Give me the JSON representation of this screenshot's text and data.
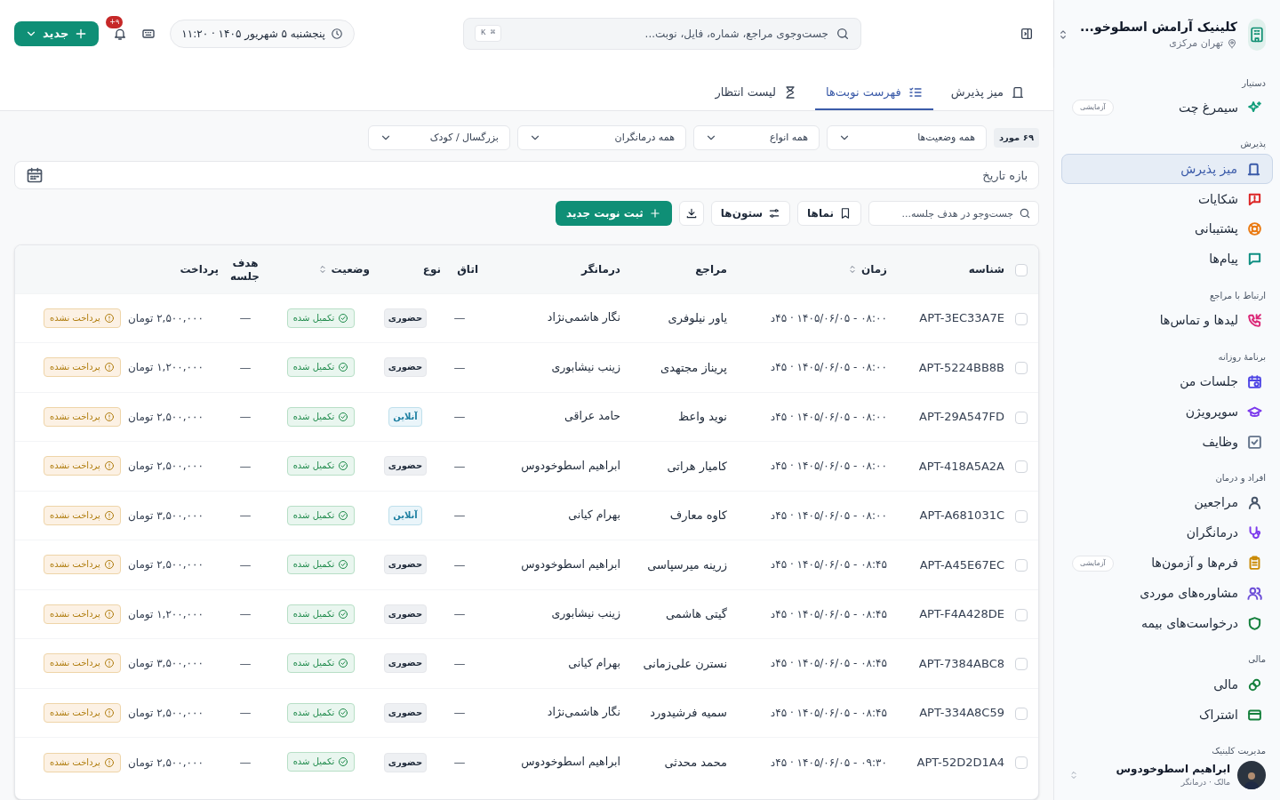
{
  "clinic": {
    "name": "کلینیک آرامش اسطوخو...",
    "location": "تهران مرکزی"
  },
  "sidebar": {
    "groups": [
      {
        "title": "دستیار",
        "items": [
          {
            "label": "سیمرغ چت",
            "selected": false,
            "color": "#0f9d7a",
            "badge": "آزمایشی"
          }
        ]
      },
      {
        "title": "پذیرش",
        "items": [
          {
            "label": "میز پذیرش",
            "selected": true,
            "color": "#3b5ba9"
          },
          {
            "label": "شکایات",
            "selected": false,
            "color": "#dc2626"
          },
          {
            "label": "پشتیبانی",
            "selected": false,
            "color": "#ea7a12"
          },
          {
            "label": "پیام‌ها",
            "selected": false,
            "color": "#0f8f82"
          }
        ]
      },
      {
        "title": "ارتباط با مراجع",
        "items": [
          {
            "label": "لیدها و تماس‌ها",
            "selected": false,
            "color": "#db2777"
          }
        ]
      },
      {
        "title": "برنامهٔ روزانه",
        "items": [
          {
            "label": "جلسات من",
            "selected": false,
            "color": "#4f46e5"
          },
          {
            "label": "سوپرویژن",
            "selected": false,
            "color": "#7c3aed"
          },
          {
            "label": "وظایف",
            "selected": false,
            "color": "#64748b"
          }
        ]
      },
      {
        "title": "افراد و درمان",
        "items": [
          {
            "label": "مراجعین",
            "selected": false,
            "color": "#475569"
          },
          {
            "label": "درمانگران",
            "selected": false,
            "color": "#7c3aed"
          },
          {
            "label": "فرم‌ها و آزمون‌ها",
            "selected": false,
            "color": "#ca8a04",
            "badge": "آزمایشی"
          },
          {
            "label": "مشاوره‌های موردی",
            "selected": false,
            "color": "#6d4fd8"
          },
          {
            "label": "درخواست‌های بیمه",
            "selected": false,
            "color": "#15803d"
          }
        ]
      },
      {
        "title": "مالی",
        "items": [
          {
            "label": "مالی",
            "selected": false,
            "color": "#15803d"
          },
          {
            "label": "اشتراک",
            "selected": false,
            "color": "#15803d"
          }
        ]
      },
      {
        "title": "مدیریت کلینیک"
      }
    ]
  },
  "user": {
    "name": "ابراهیم اسطوخودوس",
    "role": "مالک · درمانگر"
  },
  "topbar": {
    "search_placeholder": "جست‌وجوی مراجع، شماره، فایل، نوبت...",
    "shortcut": "⌘ K",
    "datetime": "پنجشنبه ۵ شهریور ۱۴۰۵ · ۱۱:۲۰",
    "notifications": "۹+",
    "new_button": "جدید"
  },
  "tabs": [
    {
      "label": "میز پذیرش",
      "selected": false
    },
    {
      "label": "فهرست نوبت‌ها",
      "selected": true
    },
    {
      "label": "لیست انتظار",
      "selected": false
    }
  ],
  "count": "۶۹ مورد",
  "filters": [
    "همه وضعیت‌ها",
    "همه انواع",
    "همه درمانگران",
    "بزرگسال / کودک"
  ],
  "date_range": {
    "placeholder": "بازه تاریخ"
  },
  "toolbar": {
    "search_placeholder": "جست‌وجو در هدف جلسه...",
    "views": "نماها",
    "columns": "ستون‌ها",
    "add": "ثبت نوبت جدید"
  },
  "table": {
    "select_all": {
      "checked": false
    },
    "columns": [
      {
        "label": "شناسه",
        "sortable": false
      },
      {
        "label": "زمان",
        "sortable": true
      },
      {
        "label": "مراجع",
        "sortable": false
      },
      {
        "label": "درمانگر",
        "sortable": false
      },
      {
        "label": "اتاق",
        "sortable": false
      },
      {
        "label": "نوع",
        "sortable": false
      },
      {
        "label": "وضعیت",
        "sortable": true
      },
      {
        "label": "هدف جلسه",
        "sortable": false
      },
      {
        "label": "پرداخت",
        "sortable": false
      }
    ],
    "rows": [
      {
        "checked": false,
        "id": "APT-3EC33A7E",
        "time": "۰۸:۰۰ - ۱۴۰۵/۰۶/۰۵ · ۴۵د",
        "client": "یاور نیلوفری",
        "therapist": "نگار هاشمی‌نژاد",
        "room": "—",
        "type": {
          "kind": "in_person",
          "label": "حضوری"
        },
        "status": {
          "kind": "completed",
          "label": "تکمیل شده"
        },
        "goal": "—",
        "payment": {
          "kind": "unpaid",
          "label": "پرداخت نشده"
        },
        "amount": "۲,۵۰۰,۰۰۰ تومان"
      },
      {
        "checked": false,
        "id": "APT-5224BB8B",
        "time": "۰۸:۰۰ - ۱۴۰۵/۰۶/۰۵ · ۴۵د",
        "client": "پریناز مجتهدی",
        "therapist": "زینب نیشابوری",
        "room": "—",
        "type": {
          "kind": "in_person",
          "label": "حضوری"
        },
        "status": {
          "kind": "completed",
          "label": "تکمیل شده"
        },
        "goal": "—",
        "payment": {
          "kind": "unpaid",
          "label": "پرداخت نشده"
        },
        "amount": "۱,۲۰۰,۰۰۰ تومان"
      },
      {
        "checked": false,
        "id": "APT-29A547FD",
        "time": "۰۸:۰۰ - ۱۴۰۵/۰۶/۰۵ · ۴۵د",
        "client": "نوید واعظ",
        "therapist": "حامد عراقی",
        "room": "—",
        "type": {
          "kind": "online",
          "label": "آنلاین"
        },
        "status": {
          "kind": "completed",
          "label": "تکمیل شده"
        },
        "goal": "—",
        "payment": {
          "kind": "unpaid",
          "label": "پرداخت نشده"
        },
        "amount": "۲,۵۰۰,۰۰۰ تومان"
      },
      {
        "checked": false,
        "id": "APT-418A5A2A",
        "time": "۰۸:۰۰ - ۱۴۰۵/۰۶/۰۵ · ۴۵د",
        "client": "کامیار هراتی",
        "therapist": "ابراهیم اسطوخودوس",
        "room": "—",
        "type": {
          "kind": "in_person",
          "label": "حضوری"
        },
        "status": {
          "kind": "completed",
          "label": "تکمیل شده"
        },
        "goal": "—",
        "payment": {
          "kind": "unpaid",
          "label": "پرداخت نشده"
        },
        "amount": "۲,۵۰۰,۰۰۰ تومان"
      },
      {
        "checked": false,
        "id": "APT-A681031C",
        "time": "۰۸:۰۰ - ۱۴۰۵/۰۶/۰۵ · ۴۵د",
        "client": "کاوه معارف",
        "therapist": "بهرام کیانی",
        "room": "—",
        "type": {
          "kind": "online",
          "label": "آنلاین"
        },
        "status": {
          "kind": "completed",
          "label": "تکمیل شده"
        },
        "goal": "—",
        "payment": {
          "kind": "unpaid",
          "label": "پرداخت نشده"
        },
        "amount": "۳,۵۰۰,۰۰۰ تومان"
      },
      {
        "checked": false,
        "id": "APT-A45E67EC",
        "time": "۰۸:۴۵ - ۱۴۰۵/۰۶/۰۵ · ۴۵د",
        "client": "زرینه میرسپاسی",
        "therapist": "ابراهیم اسطوخودوس",
        "room": "—",
        "type": {
          "kind": "in_person",
          "label": "حضوری"
        },
        "status": {
          "kind": "completed",
          "label": "تکمیل شده"
        },
        "goal": "—",
        "payment": {
          "kind": "unpaid",
          "label": "پرداخت نشده"
        },
        "amount": "۲,۵۰۰,۰۰۰ تومان"
      },
      {
        "checked": false,
        "id": "APT-F4A428DE",
        "time": "۰۸:۴۵ - ۱۴۰۵/۰۶/۰۵ · ۴۵د",
        "client": "گیتی هاشمی",
        "therapist": "زینب نیشابوری",
        "room": "—",
        "type": {
          "kind": "in_person",
          "label": "حضوری"
        },
        "status": {
          "kind": "completed",
          "label": "تکمیل شده"
        },
        "goal": "—",
        "payment": {
          "kind": "unpaid",
          "label": "پرداخت نشده"
        },
        "amount": "۱,۲۰۰,۰۰۰ تومان"
      },
      {
        "checked": false,
        "id": "APT-7384ABC8",
        "time": "۰۸:۴۵ - ۱۴۰۵/۰۶/۰۵ · ۴۵د",
        "client": "نسترن علی‌زمانی",
        "therapist": "بهرام کیانی",
        "room": "—",
        "type": {
          "kind": "in_person",
          "label": "حضوری"
        },
        "status": {
          "kind": "completed",
          "label": "تکمیل شده"
        },
        "goal": "—",
        "payment": {
          "kind": "unpaid",
          "label": "پرداخت نشده"
        },
        "amount": "۳,۵۰۰,۰۰۰ تومان"
      },
      {
        "checked": false,
        "id": "APT-334A8C59",
        "time": "۰۸:۴۵ - ۱۴۰۵/۰۶/۰۵ · ۴۵د",
        "client": "سمیه فرشیدورد",
        "therapist": "نگار هاشمی‌نژاد",
        "room": "—",
        "type": {
          "kind": "in_person",
          "label": "حضوری"
        },
        "status": {
          "kind": "completed",
          "label": "تکمیل شده"
        },
        "goal": "—",
        "payment": {
          "kind": "unpaid",
          "label": "پرداخت نشده"
        },
        "amount": "۲,۵۰۰,۰۰۰ تومان"
      },
      {
        "checked": false,
        "id": "APT-52D2D1A4",
        "time": "۰۹:۳۰ - ۱۴۰۵/۰۶/۰۵ · ۴۵د",
        "client": "محمد محدثی",
        "therapist": "ابراهیم اسطوخودوس",
        "room": "—",
        "type": {
          "kind": "in_person",
          "label": "حضوری"
        },
        "status": {
          "kind": "completed",
          "label": "تکمیل شده"
        },
        "goal": "—",
        "payment": {
          "kind": "unpaid",
          "label": "پرداخت نشده"
        },
        "amount": "۲,۵۰۰,۰۰۰ تومان"
      }
    ]
  }
}
